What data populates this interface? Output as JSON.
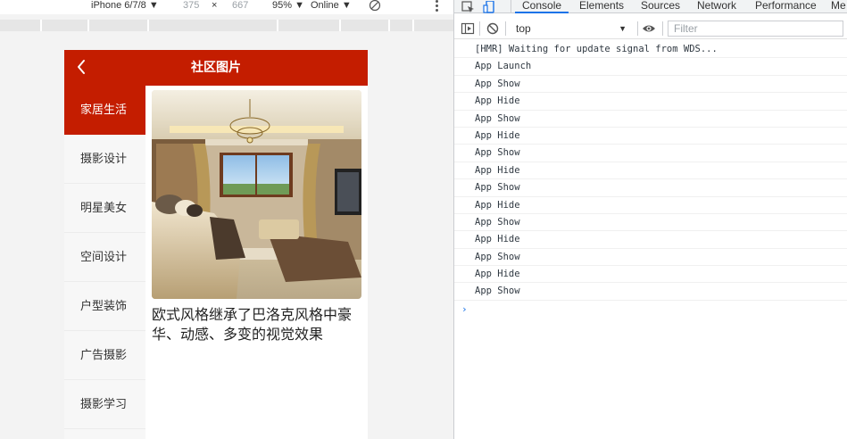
{
  "device_toolbar": {
    "device": "iPhone 6/7/8 ▼",
    "width": "375",
    "times": "×",
    "height": "667",
    "zoom": "95% ▼",
    "network": "Online ▼"
  },
  "app": {
    "title": "社区图片",
    "accent": "#c41d00",
    "categories": [
      {
        "label": "家居生活",
        "active": true
      },
      {
        "label": "摄影设计",
        "active": false
      },
      {
        "label": "明星美女",
        "active": false
      },
      {
        "label": "空间设计",
        "active": false
      },
      {
        "label": "户型装饰",
        "active": false
      },
      {
        "label": "广告摄影",
        "active": false
      },
      {
        "label": "摄影学习",
        "active": false
      }
    ],
    "item": {
      "caption": "欧式风格继承了巴洛克风格中豪华、动感、多变的视觉效果"
    }
  },
  "devtools": {
    "tabs": [
      "Console",
      "Elements",
      "Sources",
      "Network",
      "Performance",
      "Me"
    ],
    "active_tab": "Console",
    "context": "top",
    "filter_placeholder": "Filter",
    "log": [
      "[HMR] Waiting for update signal from WDS...",
      "App Launch",
      "App Show",
      "App Hide",
      "App Show",
      "App Hide",
      "App Show",
      "App Hide",
      "App Show",
      "App Hide",
      "App Show",
      "App Hide",
      "App Show",
      "App Hide",
      "App Show"
    ],
    "prompt": "›"
  }
}
